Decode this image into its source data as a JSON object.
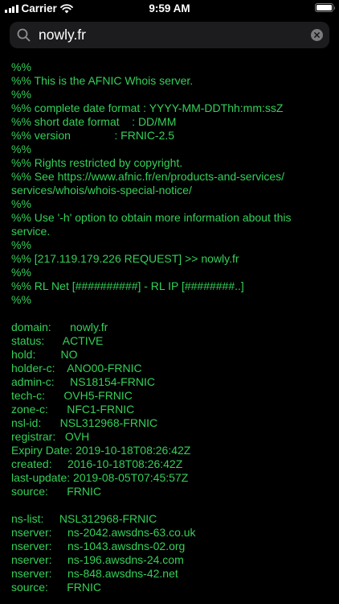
{
  "status_bar": {
    "carrier": "Carrier",
    "time": "9:59 AM",
    "icons": [
      "signal-icon",
      "wifi-icon",
      "battery-icon"
    ]
  },
  "search": {
    "value": "nowly.fr",
    "icon": "search-icon",
    "clear_icon": "clear-icon"
  },
  "colors": {
    "background": "#000000",
    "text_green": "#34d058",
    "search_bg": "#1c1c1e"
  },
  "whois_lines": [
    "%%",
    "%% This is the AFNIC Whois server.",
    "%%",
    "%% complete date format : YYYY-MM-DDThh:mm:ssZ",
    "%% short date format    : DD/MM",
    "%% version              : FRNIC-2.5",
    "%%",
    "%% Rights restricted by copyright.",
    "%% See https://www.afnic.fr/en/products-and-services/",
    "services/whois/whois-special-notice/",
    "%%",
    "%% Use '-h' option to obtain more information about this",
    "service.",
    "%%",
    "%% [217.119.179.226 REQUEST] >> nowly.fr",
    "%%",
    "%% RL Net [##########] - RL IP [########..]",
    "%%",
    "",
    "domain:      nowly.fr",
    "status:      ACTIVE",
    "hold:        NO",
    "holder-c:    ANO00-FRNIC",
    "admin-c:     NS18154-FRNIC",
    "tech-c:      OVH5-FRNIC",
    "zone-c:      NFC1-FRNIC",
    "nsl-id:      NSL312968-FRNIC",
    "registrar:   OVH",
    "Expiry Date: 2019-10-18T08:26:42Z",
    "created:     2016-10-18T08:26:42Z",
    "last-update: 2019-08-05T07:45:57Z",
    "source:      FRNIC",
    "",
    "ns-list:     NSL312968-FRNIC",
    "nserver:     ns-2042.awsdns-63.co.uk",
    "nserver:     ns-1043.awsdns-02.org",
    "nserver:     ns-196.awsdns-24.com",
    "nserver:     ns-848.awsdns-42.net",
    "source:      FRNIC"
  ]
}
